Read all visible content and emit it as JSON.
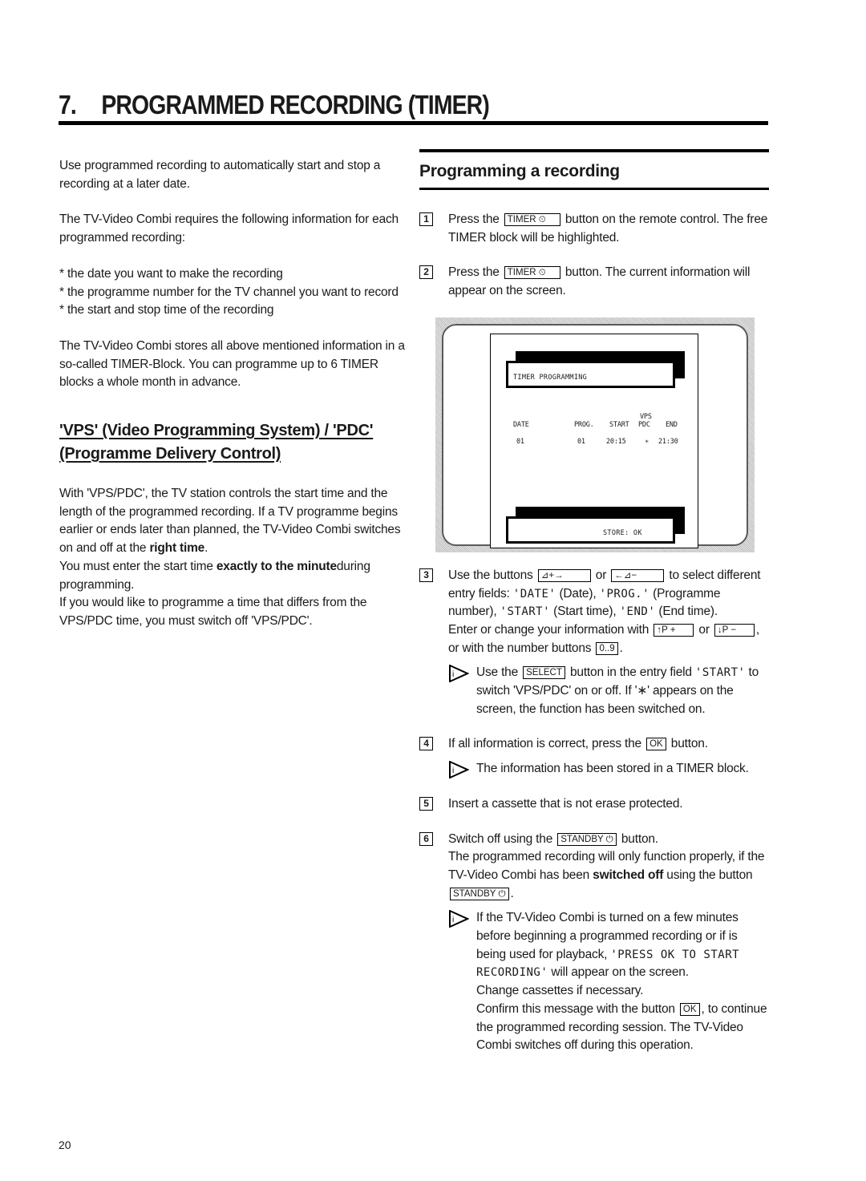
{
  "chapter": {
    "number": "7.",
    "title": "PROGRAMMED RECORDING (TIMER)"
  },
  "left": {
    "intro": "Use programmed recording to automatically start and stop a recording at a later date.",
    "requires": "The TV-Video Combi requires the following information for each programmed recording:",
    "bullets": [
      "* the date you want to make the recording",
      "* the programme number for the TV channel you want to record",
      "* the start and stop time of the recording"
    ],
    "stores": "The TV-Video Combi stores all above mentioned information in a so-called TIMER-Block. You can programme up to 6 TIMER blocks a whole month in advance.",
    "vps_heading": "'VPS' (Video Programming System) / 'PDC' (Programme Delivery Control)",
    "vps_p1_a": "With 'VPS/PDC', the TV station controls the start time and the length of the programmed recording. If a TV programme begins earlier or ends later than planned, the TV-Video Combi switches on and off at the ",
    "vps_p1_bold": "right time",
    "vps_p1_c": ".",
    "vps_p2_a": "You must enter the start time ",
    "vps_p2_bold": "exactly to the minute",
    "vps_p2_c": "during programming.",
    "vps_p3": "If you would like to programme a time that differs from the VPS/PDC time, you must switch off 'VPS/PDC'."
  },
  "right": {
    "section_title": "Programming a recording",
    "steps": [
      {
        "num": "1",
        "a": "Press the ",
        "key": "TIMER ⏲",
        "b": " button on the remote control. The free TIMER block will be highlighted."
      },
      {
        "num": "2",
        "a": "Press the ",
        "key": "TIMER ⏲",
        "b": " button. The current information will appear on the screen."
      },
      {
        "num": "3",
        "a": "Use the buttons ",
        "key1": "⊿+→",
        "or1": " or ",
        "key2": "←⊿−",
        "b": " to select different entry fields: ",
        "f1": "'DATE'",
        "f1d": " (Date), ",
        "f2": "'PROG.'",
        "f2d": " (Programme number), ",
        "f3": "'START'",
        "f3d": " (Start time), ",
        "f4": "'END'",
        "f4d": " (End time).",
        "c": "Enter or change your information with ",
        "key3": "↑P +",
        "or2": " or ",
        "key4": "↓P −",
        "d": ", or with the number buttons ",
        "key5": "0..9",
        "e": ".",
        "note_a": "Use the ",
        "note_key": "SELECT",
        "note_b": " button in the entry field ",
        "note_field": "'START'",
        "note_c": " to switch 'VPS/PDC' on or off. If '∗' appears on the screen, the function has been switched on."
      },
      {
        "num": "4",
        "a": "If all information is correct, press the ",
        "key": "OK",
        "b": " button.",
        "note": "The information has been stored in a TIMER block."
      },
      {
        "num": "5",
        "a": "Insert a cassette that is not erase protected."
      },
      {
        "num": "6",
        "a": "Switch off using the ",
        "key": "STANDBY ⏻",
        "b": " button.",
        "c": "The programmed recording will only function properly, if the TV-Video Combi has been ",
        "bold": "switched off",
        "d": " using the button ",
        "key2": "STANDBY ⏻",
        "e": ".",
        "note_a": "If the TV-Video Combi is turned on a few minutes before beginning a programmed recording or if is being used for playback, ",
        "note_mono": "'PRESS OK TO START RECORDING'",
        "note_b": " will appear on the screen.",
        "note_c": "Change cassettes if necessary.",
        "note_d": "Confirm this message with the button ",
        "note_key": "OK",
        "note_e": ", to continue the programmed recording session. The TV-Video Combi switches off during this operation."
      }
    ]
  },
  "tv_screen": {
    "title": "TIMER PROGRAMMING",
    "headers": {
      "date": "DATE",
      "prog": "PROG.",
      "start": "START",
      "vps_top": "VPS",
      "vps_bottom": "PDC",
      "end": "END"
    },
    "row": {
      "date": "01",
      "prog": "01",
      "start": "20:15",
      "vps": "∗",
      "end": "21:30"
    },
    "footer": "STORE: OK"
  },
  "page_number": "20"
}
